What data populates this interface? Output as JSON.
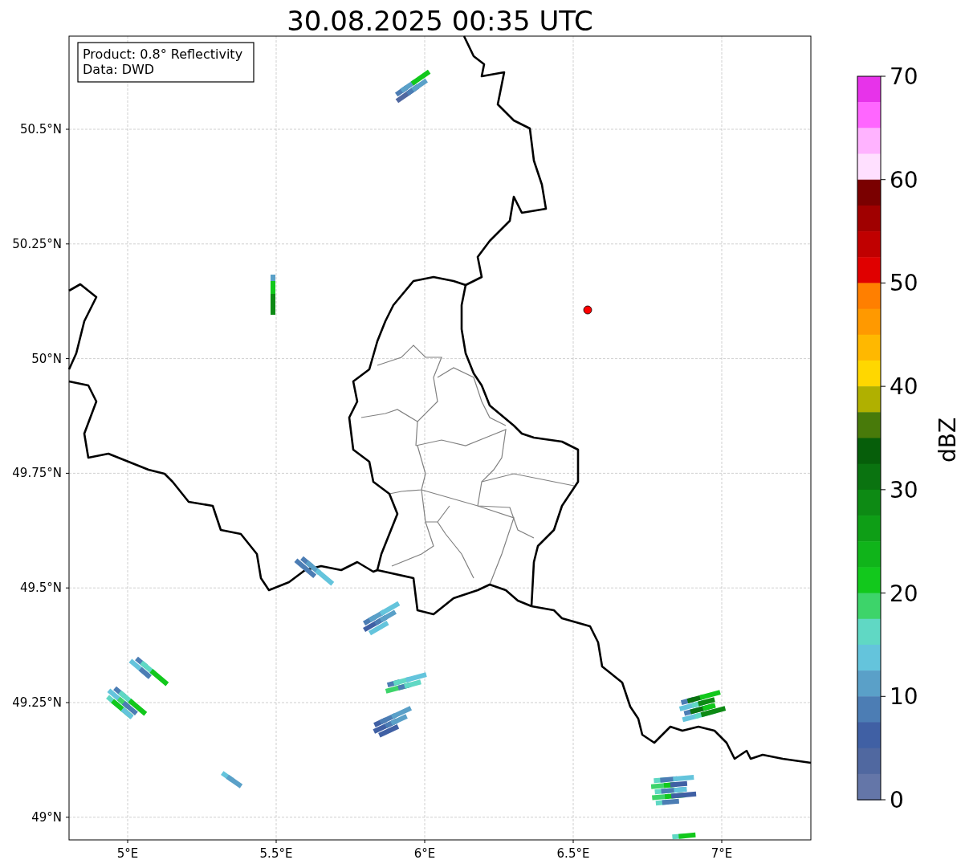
{
  "title": "30.08.2025 00:35 UTC",
  "info_box": [
    "Product: 0.8° Reflectivity",
    "Data: DWD"
  ],
  "lat_ticks": [
    "50.5°N",
    "50.25°N",
    "50°N",
    "49.75°N",
    "49.5°N",
    "49.25°N",
    "49°N"
  ],
  "lon_ticks": [
    "5°E",
    "5.5°E",
    "6°E",
    "6.5°E",
    "7°E"
  ],
  "colorbar": {
    "label": "dBZ",
    "ticks": [
      "70",
      "60",
      "50",
      "40",
      "30",
      "20",
      "10",
      "0"
    ],
    "bins": [
      {
        "color": "#e733ea"
      },
      {
        "color": "#ff66ff"
      },
      {
        "color": "#ffb3ff"
      },
      {
        "color": "#ffe0ff"
      },
      {
        "color": "#7a0000"
      },
      {
        "color": "#a00000"
      },
      {
        "color": "#c00000"
      },
      {
        "color": "#e00000"
      },
      {
        "color": "#ff7f00"
      },
      {
        "color": "#ff9900"
      },
      {
        "color": "#ffb800"
      },
      {
        "color": "#ffd700"
      },
      {
        "color": "#b0b000"
      },
      {
        "color": "#487a0a"
      },
      {
        "color": "#065e0a"
      },
      {
        "color": "#0a7310"
      },
      {
        "color": "#0d8a14"
      },
      {
        "color": "#0e9e16"
      },
      {
        "color": "#10b41a"
      },
      {
        "color": "#12c81c"
      },
      {
        "color": "#3dd46a"
      },
      {
        "color": "#60d8c4"
      },
      {
        "color": "#64c4dc"
      },
      {
        "color": "#5aa0c8"
      },
      {
        "color": "#4c7db4"
      },
      {
        "color": "#4060a4"
      },
      {
        "color": "#5068a0"
      },
      {
        "color": "#6476a8"
      }
    ]
  }
}
